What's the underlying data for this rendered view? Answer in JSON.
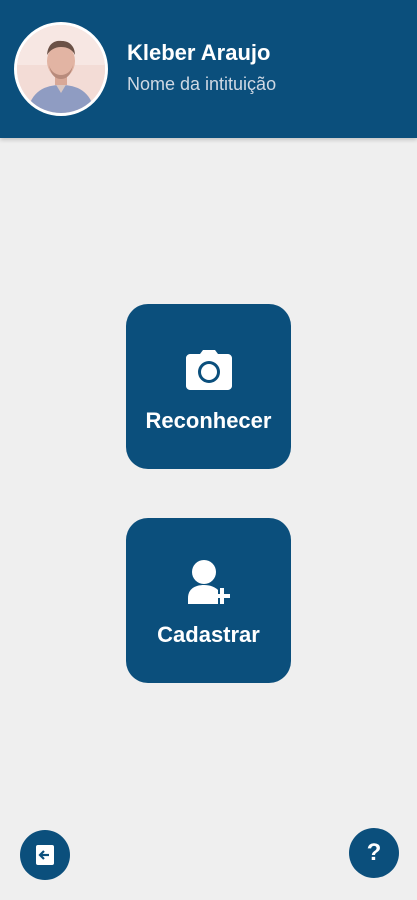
{
  "header": {
    "user_name": "Kleber Araujo",
    "institution": "Nome da intituição",
    "avatar_icon": "user-photo"
  },
  "actions": [
    {
      "label": "Reconhecer",
      "icon": "camera-icon"
    },
    {
      "label": "Cadastrar",
      "icon": "add-user-icon"
    }
  ],
  "footer": {
    "logout_icon": "logout-icon",
    "help_label": "?"
  },
  "colors": {
    "primary": "#0b4f7c",
    "background": "#efefef",
    "text_on_primary": "#ffffff",
    "subtitle": "#cfd8e3"
  }
}
